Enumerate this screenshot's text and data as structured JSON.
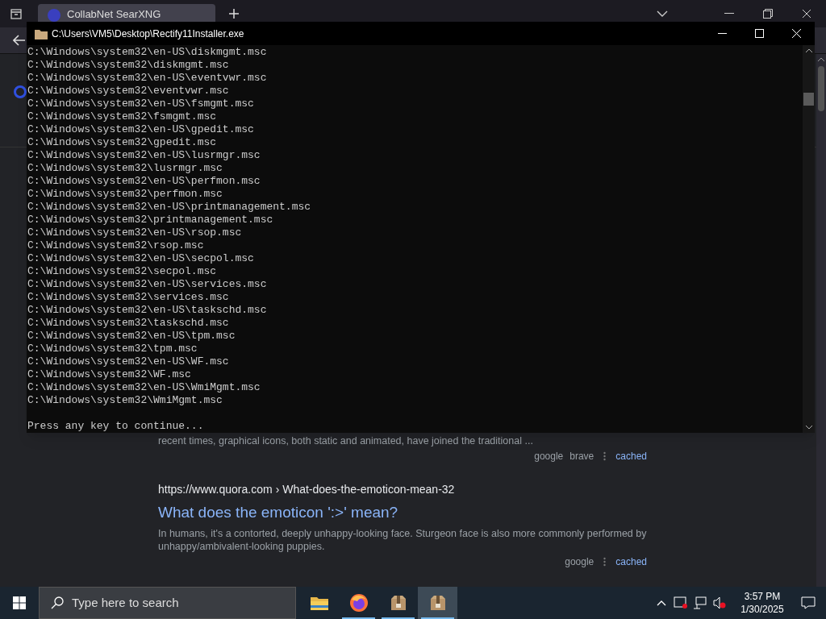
{
  "browser": {
    "tab": {
      "title": "CollabNet SearXNG",
      "selected": true
    },
    "results": [
      {
        "snippet": "recent times, graphical icons, both static and animated, have joined the traditional ...",
        "engines": [
          "google",
          "brave"
        ],
        "cached": "cached"
      },
      {
        "host": "https://www.quora.com",
        "path": "› What-does-the-emoticon-mean-32",
        "title": "What does the emoticon ':>' mean?",
        "snippet": "In humans, it's a contorted, deeply unhappy-looking face. Sturgeon face is also more commonly performed by unhappy/ambivalent-looking puppies.",
        "engines": [
          "google"
        ],
        "cached": "cached"
      }
    ]
  },
  "console": {
    "title": "C:\\Users\\VM5\\Desktop\\Rectify11Installer.exe",
    "lines": [
      "C:\\Windows\\system32\\en-US\\diskmgmt.msc",
      "C:\\Windows\\system32\\diskmgmt.msc",
      "C:\\Windows\\system32\\en-US\\eventvwr.msc",
      "C:\\Windows\\system32\\eventvwr.msc",
      "C:\\Windows\\system32\\en-US\\fsmgmt.msc",
      "C:\\Windows\\system32\\fsmgmt.msc",
      "C:\\Windows\\system32\\en-US\\gpedit.msc",
      "C:\\Windows\\system32\\gpedit.msc",
      "C:\\Windows\\system32\\en-US\\lusrmgr.msc",
      "C:\\Windows\\system32\\lusrmgr.msc",
      "C:\\Windows\\system32\\en-US\\perfmon.msc",
      "C:\\Windows\\system32\\perfmon.msc",
      "C:\\Windows\\system32\\en-US\\printmanagement.msc",
      "C:\\Windows\\system32\\printmanagement.msc",
      "C:\\Windows\\system32\\en-US\\rsop.msc",
      "C:\\Windows\\system32\\rsop.msc",
      "C:\\Windows\\system32\\en-US\\secpol.msc",
      "C:\\Windows\\system32\\secpol.msc",
      "C:\\Windows\\system32\\en-US\\services.msc",
      "C:\\Windows\\system32\\services.msc",
      "C:\\Windows\\system32\\en-US\\taskschd.msc",
      "C:\\Windows\\system32\\taskschd.msc",
      "C:\\Windows\\system32\\en-US\\tpm.msc",
      "C:\\Windows\\system32\\tpm.msc",
      "C:\\Windows\\system32\\en-US\\WF.msc",
      "C:\\Windows\\system32\\WF.msc",
      "C:\\Windows\\system32\\en-US\\WmiMgmt.msc",
      "C:\\Windows\\system32\\WmiMgmt.msc"
    ],
    "prompt": "Press any key to continue..."
  },
  "taskbar": {
    "search_placeholder": "Type here to search",
    "apps": [
      {
        "kind": "folder",
        "running": false,
        "selected": false
      },
      {
        "kind": "browser",
        "running": true,
        "selected": false
      },
      {
        "kind": "package",
        "running": true,
        "selected": false
      },
      {
        "kind": "package",
        "running": true,
        "selected": true
      }
    ],
    "time": "3:57 PM",
    "date": "1/30/2025"
  }
}
